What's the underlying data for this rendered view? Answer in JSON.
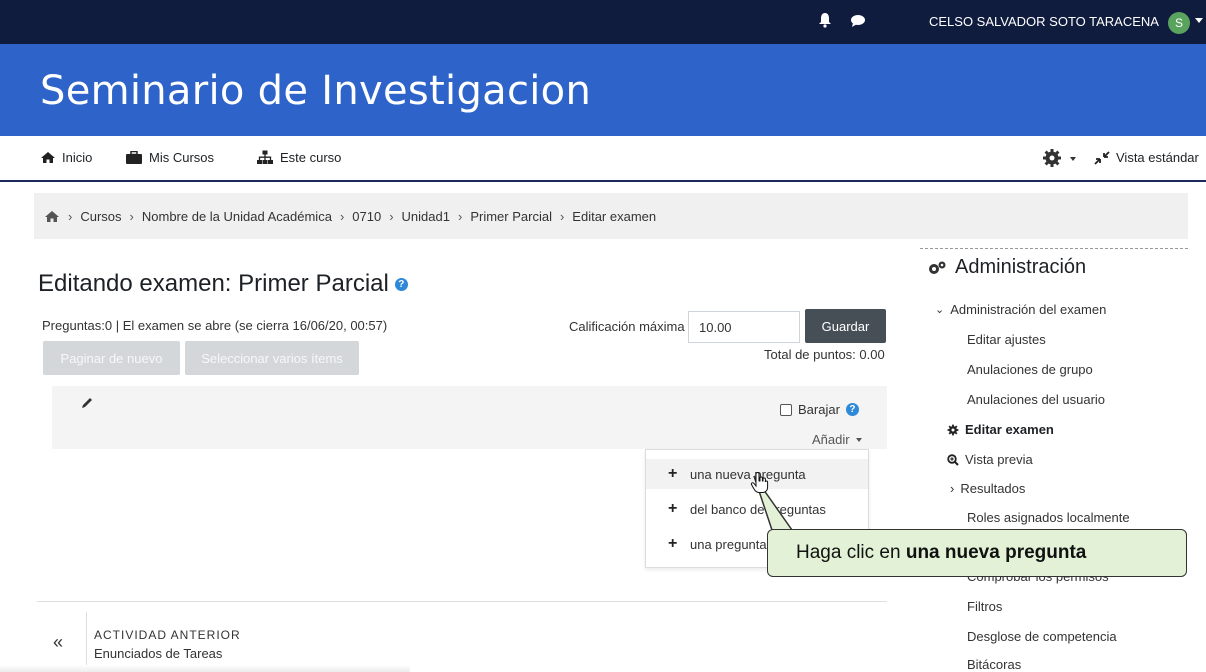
{
  "topbar": {
    "username": "CELSO SALVADOR SOTO TARACENA",
    "avatar_initial": "S",
    "icons": [
      "bell-icon",
      "chat-icon",
      "chevron-down-icon"
    ]
  },
  "banner": {
    "title": "Seminario de Investigacion"
  },
  "nav": {
    "home": "Inicio",
    "my_courses": "Mis Cursos",
    "this_course": "Este curso",
    "standard_view": "Vista estándar"
  },
  "breadcrumb": [
    "Cursos",
    "Nombre de la Unidad Académica",
    "0710",
    "Unidad1",
    "Primer Parcial",
    "Editar examen"
  ],
  "main": {
    "title": "Editando examen: Primer Parcial",
    "info": "Preguntas:0 | El examen se abre (se cierra 16/06/20, 00:57)",
    "repaginate": "Paginar de nuevo",
    "select_multiple": "Seleccionar varios ítems",
    "max_grade_label": "Calificación máxima",
    "max_grade_value": "10.00",
    "save": "Guardar",
    "total_points": "Total de puntos: 0.00",
    "shuffle": "Barajar",
    "add": "Añadir",
    "add_menu": [
      "una nueva pregunta",
      "del banco de preguntas",
      "una pregunta aleatoria"
    ]
  },
  "footer": {
    "prev_label": "ACTIVIDAD ANTERIOR",
    "prev_title": "Enunciados de Tareas",
    "prev_arrows": "«"
  },
  "sidebar": {
    "heading": "Administración",
    "section": "Administración del examen",
    "items": [
      "Editar ajustes",
      "Anulaciones de grupo",
      "Anulaciones del usuario",
      "Editar examen",
      "Vista previa",
      "Resultados",
      "Roles asignados localmente",
      "Comprobar los permisos",
      "Filtros",
      "Desglose de competencia",
      "Bitácoras"
    ]
  },
  "callout": {
    "prefix": "Haga clic en ",
    "bold": "una nueva pregunta"
  },
  "colors": {
    "topbar": "#101c3e",
    "banner": "#2e64c9",
    "callout": "#e3f2d7",
    "help": "#2e8ad8"
  }
}
